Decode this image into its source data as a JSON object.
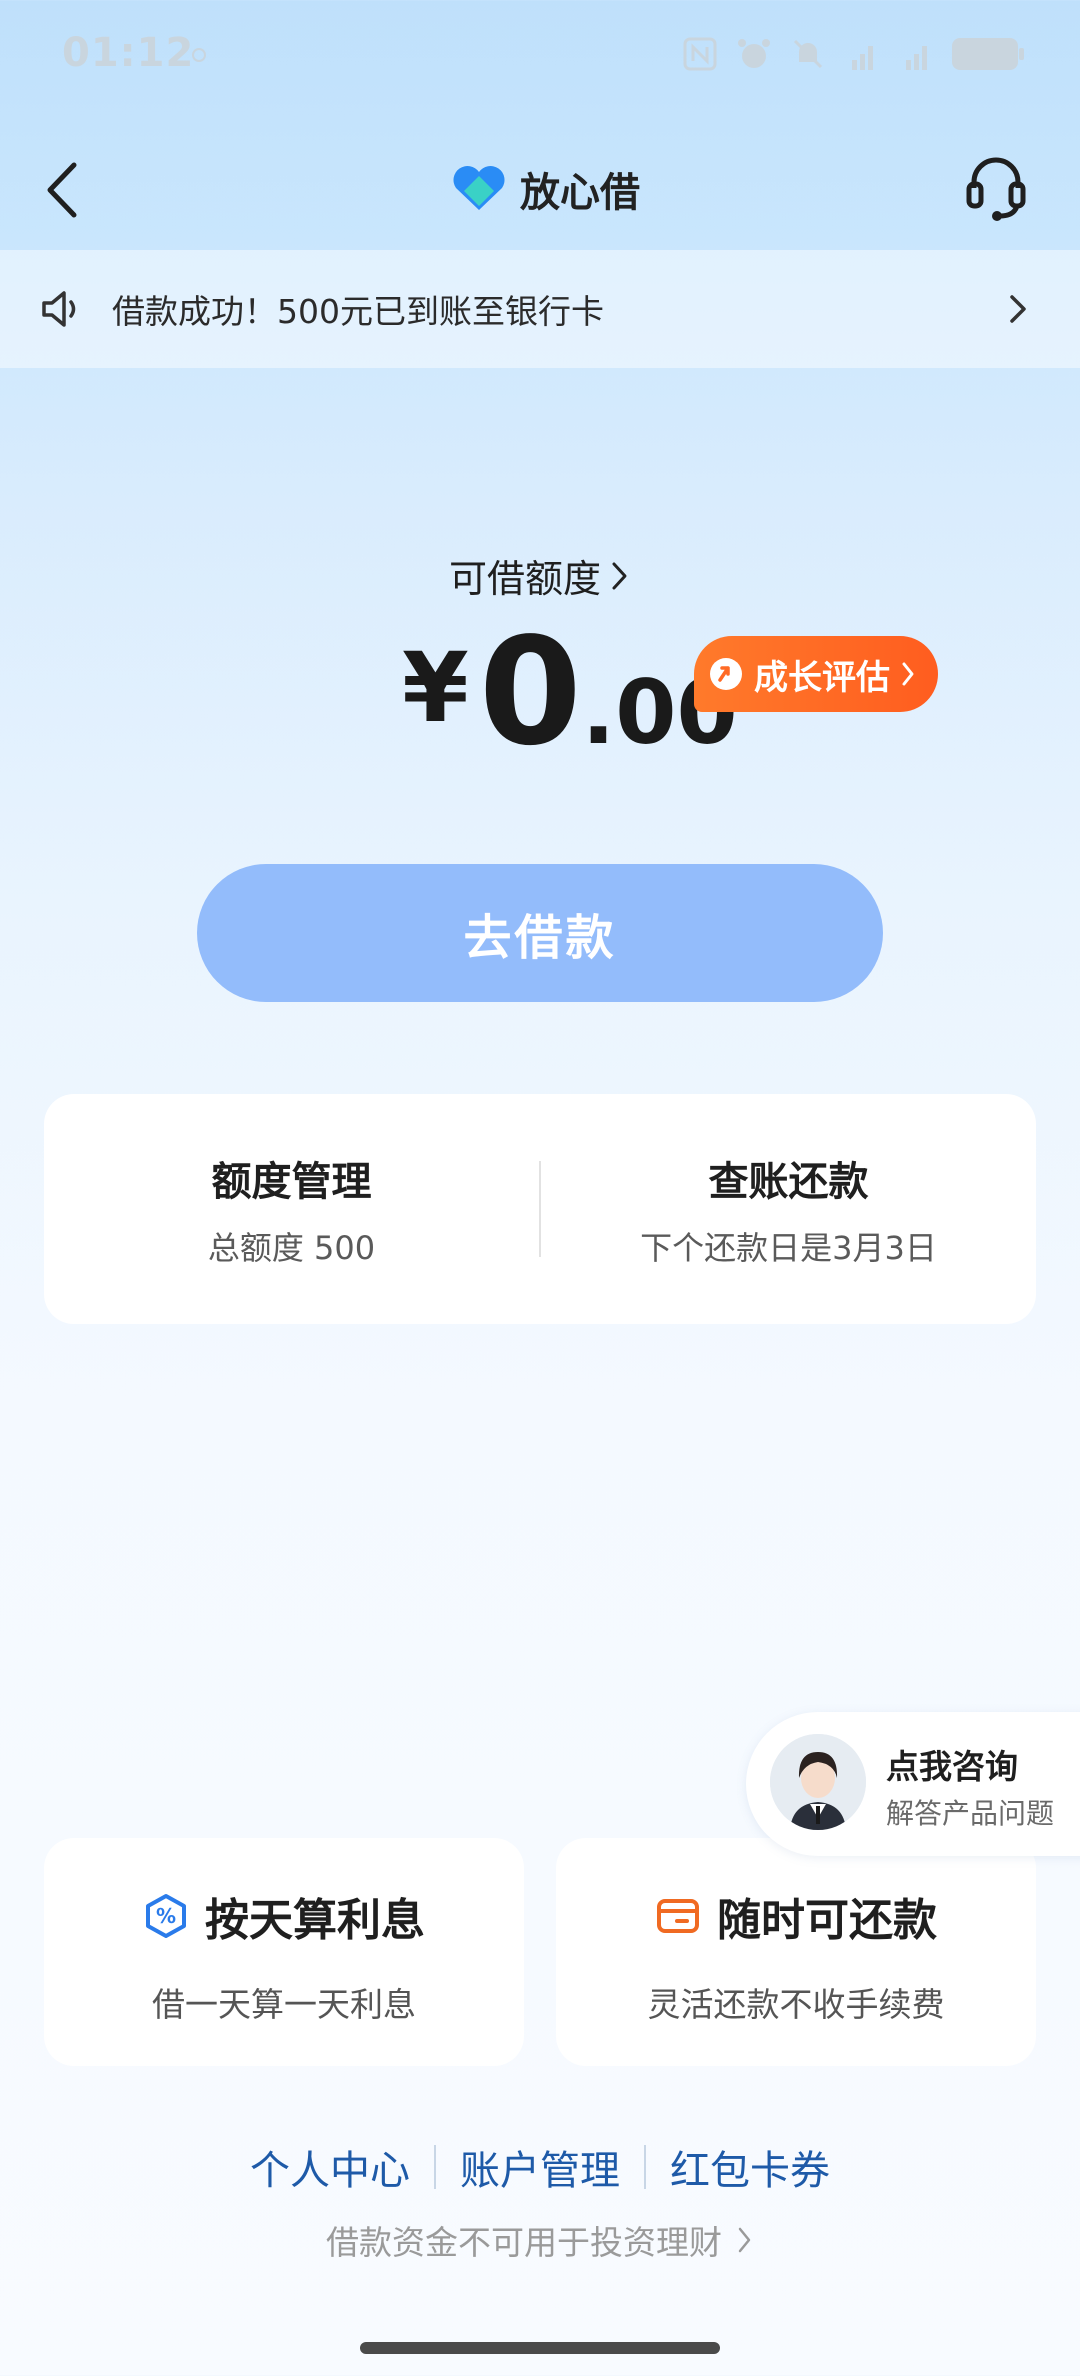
{
  "status_bar": {
    "time": "01:12"
  },
  "header": {
    "app_name": "放心借"
  },
  "notice": {
    "text": "借款成功！500元已到账至银行卡"
  },
  "limit": {
    "label": "可借额度",
    "currency_symbol": "¥",
    "amount_integer": "0",
    "amount_decimal": ".00",
    "growth_badge": "成长评估"
  },
  "borrow_button": {
    "label": "去借款"
  },
  "manage": {
    "quota": {
      "title": "额度管理",
      "subtitle": "总额度 500"
    },
    "bills": {
      "title": "查账还款",
      "subtitle": "下个还款日是3月3日"
    }
  },
  "consult": {
    "title": "点我咨询",
    "subtitle": "解答产品问题"
  },
  "features": [
    {
      "title": "按天算利息",
      "subtitle": "借一天算一天利息",
      "icon": "percent-shield-icon"
    },
    {
      "title": "随时可还款",
      "subtitle": "灵活还款不收手续费",
      "icon": "wallet-icon"
    }
  ],
  "footer": {
    "links": [
      "个人中心",
      "账户管理",
      "红包卡券"
    ],
    "disclaimer": "借款资金不可用于投资理财"
  },
  "colors": {
    "accent_blue": "#93bcfb",
    "growth_orange": "#ff6a25",
    "link_blue": "#1e5aa8"
  }
}
